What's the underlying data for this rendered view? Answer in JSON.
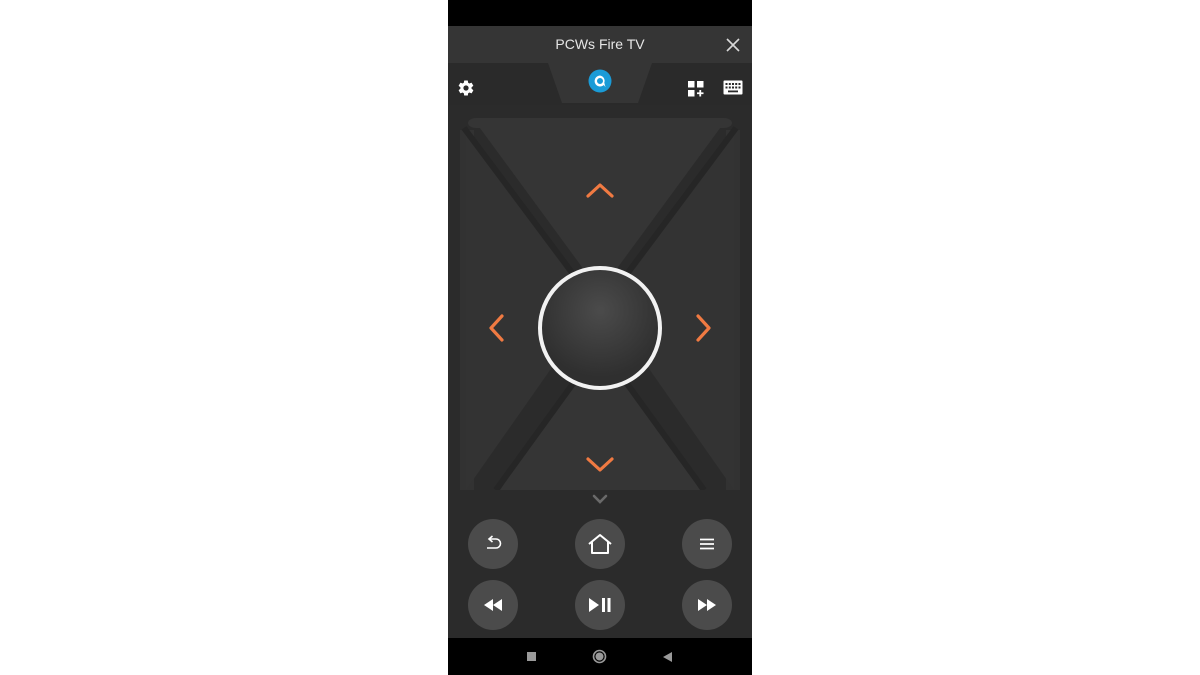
{
  "window": {
    "title": "PCWs Fire TV"
  },
  "icons": {
    "close": "close-icon",
    "settings": "gear-icon",
    "alexa": "alexa-icon",
    "apps": "apps-grid-icon",
    "keyboard": "keyboard-icon",
    "up": "chevron-up-icon",
    "down": "chevron-down-icon",
    "left": "chevron-left-icon",
    "right": "chevron-right-icon",
    "back": "back-icon",
    "home": "home-icon",
    "menu": "menu-icon",
    "rewind": "rewind-icon",
    "play_pause": "play-pause-icon",
    "fast_forward": "fast-forward-icon",
    "nav_recents": "square-icon",
    "nav_home": "circle-icon",
    "nav_back": "triangle-back-icon"
  },
  "colors": {
    "accent_arrow": "#f07a42",
    "alexa_blue": "#1a9bd7",
    "background": "#2b2b2b",
    "button": "#4b4b4b"
  }
}
